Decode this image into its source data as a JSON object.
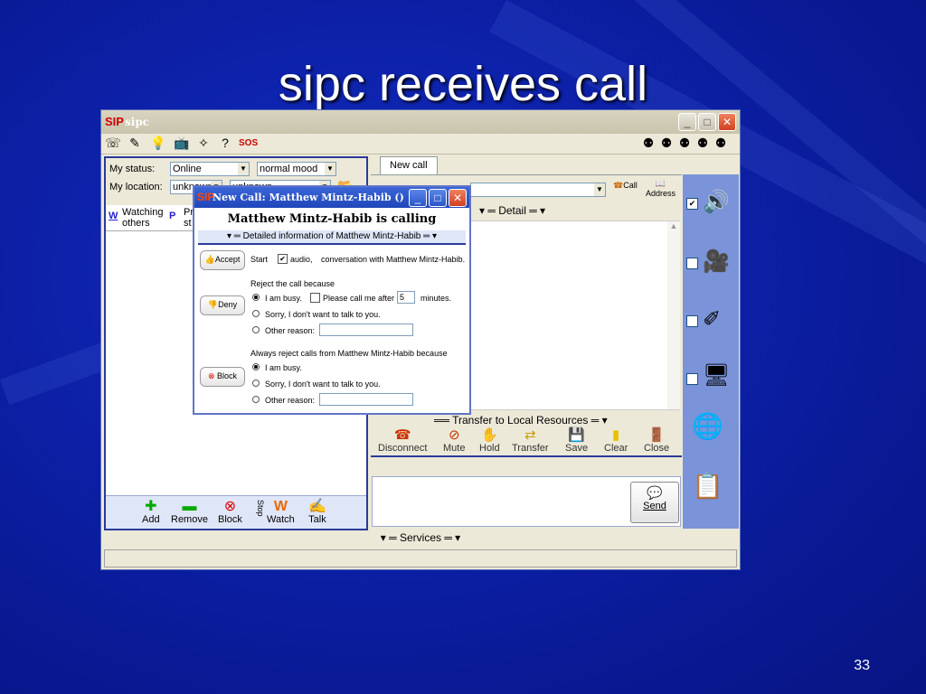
{
  "slide": {
    "title": "sipc receives call",
    "page_number": "33"
  },
  "app": {
    "logo_text": "SIP",
    "title": "sipc",
    "my_status_label": "My status:",
    "status_value": "Online",
    "mood_value": "normal mood",
    "my_location_label": "My location:",
    "location_value_1": "unknown",
    "location_value_2": "unknown",
    "watching_label": "Watching others",
    "watching_prefix": "W",
    "presence_prefix": "P",
    "presence_label": "Pr st",
    "bottom_buttons": [
      "Add",
      "Remove",
      "Block",
      "Watch",
      "Talk"
    ],
    "stop_label": "Stop",
    "services_label": "Services",
    "new_call_tab": "New call",
    "call_button": "Call",
    "address_button": "Address",
    "detail_label": "Detail",
    "transfer_label": "Transfer to Local Resources",
    "actions": [
      "Disconnect",
      "Mute",
      "Hold",
      "Transfer",
      "Save",
      "Clear",
      "Close"
    ],
    "send_button": "Send",
    "right_panel_checks": [
      true,
      false,
      false,
      false
    ]
  },
  "dialog": {
    "title": "New Call: Matthew Mintz-Habib ()",
    "calling_text": "Matthew Mintz-Habib is calling",
    "detail_header": "Detailed information of Matthew Mintz-Habib",
    "accept_button": "Accept",
    "deny_button": "Deny",
    "block_button": "Block",
    "start_label": "Start",
    "audio_label": "audio,",
    "conversation_text": "conversation with Matthew Mintz-Habib.",
    "reject_header": "Reject the call because",
    "busy_label": "I am busy.",
    "call_me_label": "Please call me after",
    "minutes_value": "5",
    "minutes_label": "minutes.",
    "sorry_label": "Sorry, I don't want to talk to you.",
    "other_reason_label": "Other reason:",
    "always_reject_header": "Always reject calls from Matthew Mintz-Habib because",
    "block_busy_label": "I am busy.",
    "block_sorry_label": "Sorry, I don't want to talk to you.",
    "block_other_label": "Other reason:"
  }
}
